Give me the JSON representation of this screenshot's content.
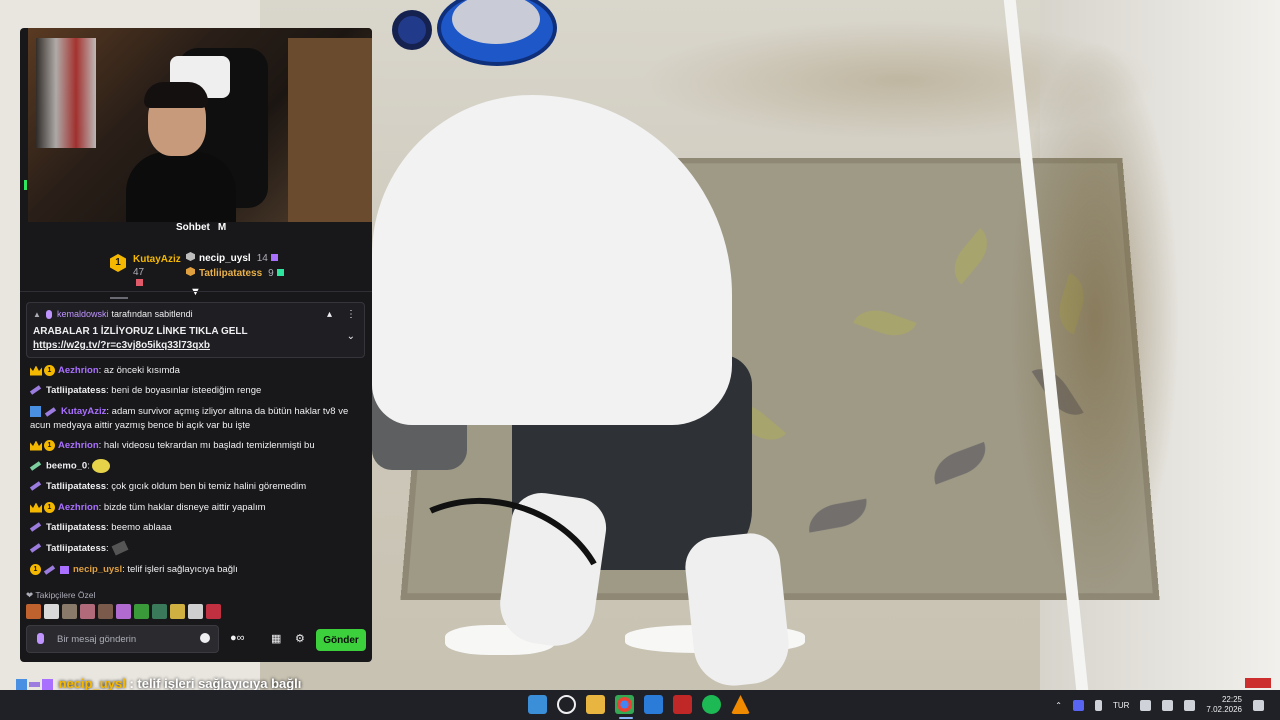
{
  "cam": {
    "label": "Sohbet",
    "label_suffix": "M"
  },
  "leaderboard": {
    "first": {
      "rank": "1",
      "name": "KutayAziz",
      "score": "47"
    },
    "second": {
      "name": "necip_uysl",
      "score": "14"
    },
    "third": {
      "name": "Tatliipatatess",
      "score": "9"
    }
  },
  "pinned": {
    "by_user": "kemaldowski",
    "by_text": "tarafından sabitlendi",
    "message": "ARABALAR 1 İZLİYORUZ LİNKE TIKLA GELL ",
    "link": "https://w2g.tv/?r=c3vj8o5ikq33l73qxb"
  },
  "chat": [
    {
      "user": "Aezhrion",
      "text": ": az önceki kısımda"
    },
    {
      "user": "Tatliipatatess",
      "text": ": beni de boyasınlar isteediğim renge"
    },
    {
      "user": "KutayAziz",
      "text": ": adam survivor açmış izliyor altına da bütün haklar tv8 ve"
    },
    {
      "text": "acun medyaya aittir yazmış bence bi açık var bu işte"
    },
    {
      "user": "Aezhrion",
      "text": ": halı videosu tekrardan mı başladı temizlenmişti bu"
    },
    {
      "user": "beemo_0",
      "text": ":"
    },
    {
      "user": "Tatliipatatess",
      "text": ": çok gıcık oldum ben bi temiz halini göremedim"
    },
    {
      "user": "Aezhrion",
      "text": ": bizde tüm haklar disneye aittir yapalım"
    },
    {
      "user": "Tatliipatatess",
      "text": ": beemo ablaaa"
    },
    {
      "user": "Tatliipatatess",
      "text": ":"
    },
    {
      "user": "necip_uysl",
      "text": ": telif işleri sağlayıcıya bağlı"
    }
  ],
  "emotes_label": "Takipçilere Özel",
  "input": {
    "placeholder": "Bir mesaj gönderin"
  },
  "send_label": "Gönder",
  "ticker": {
    "user": "necip_uysl",
    "text": " : telif işleri sağlayıcıya bağlı"
  },
  "tray": {
    "lang": "TUR",
    "time": "22:25",
    "date": "7.02.2026"
  },
  "colors": {
    "accent": "#a970ff",
    "send": "#3cd13c",
    "gold": "#f5b800"
  }
}
